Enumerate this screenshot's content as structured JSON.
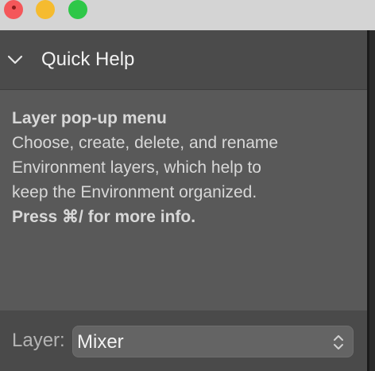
{
  "quick_help": {
    "title": "Quick Help",
    "heading": "Layer pop-up menu",
    "body_lines": [
      "Choose, create, delete, and rename",
      "Environment layers, which help to",
      "keep the Environment organized."
    ],
    "shortcut_hint": "Press ⌘/ for more info."
  },
  "footer": {
    "layer_label": "Layer:",
    "layer_value": "Mixer"
  },
  "icons": {
    "collapse": "chevron-down-icon",
    "select": "updown-chevrons-icon"
  },
  "colors": {
    "close": "#f4575a",
    "minimize": "#f5bb2f",
    "zoom": "#2ec748",
    "panel_bg": "#595959",
    "header_bg": "#4b4b4b"
  }
}
